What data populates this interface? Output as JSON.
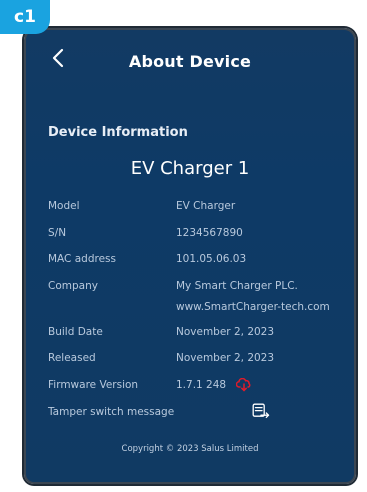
{
  "badge": {
    "label": "c1"
  },
  "header": {
    "title": "About Device"
  },
  "section": {
    "title": "Device Information"
  },
  "device": {
    "name": "EV Charger 1"
  },
  "info": {
    "model_label": "Model",
    "model_value": "EV Charger",
    "sn_label": "S/N",
    "sn_value": "1234567890",
    "mac_label": "MAC address",
    "mac_value": "101.05.06.03",
    "company_label": "Company",
    "company_name": "My Smart Charger  PLC.",
    "company_url": "www.SmartCharger-tech.com",
    "build_label": "Build Date",
    "build_value": "November 2, 2023",
    "released_label": "Released",
    "released_value": "November 2, 2023",
    "firmware_label": "Firmware Version",
    "firmware_value": "1.7.1 248",
    "tamper_label": "Tamper switch message"
  },
  "icons": {
    "back": "chevron-left-icon",
    "download": "cloud-download-icon",
    "message": "message-forward-icon",
    "download_color": "#e11b2a"
  },
  "footer": {
    "copyright": "Copyright © 2023 Salus Limited"
  }
}
